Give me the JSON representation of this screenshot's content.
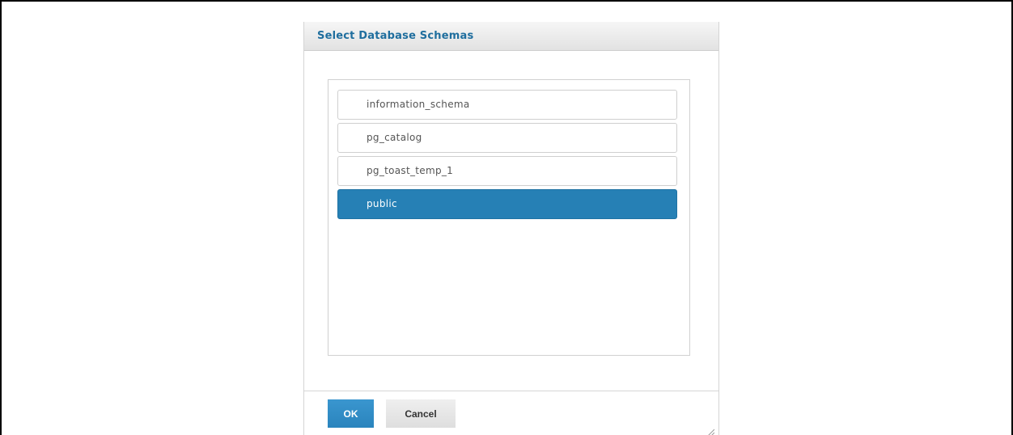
{
  "dialog": {
    "title": "Select Database Schemas"
  },
  "schemas": {
    "items": [
      {
        "label": "information_schema",
        "selected": false
      },
      {
        "label": "pg_catalog",
        "selected": false
      },
      {
        "label": "pg_toast_temp_1",
        "selected": false
      },
      {
        "label": "public",
        "selected": true
      }
    ]
  },
  "buttons": {
    "ok_label": "OK",
    "cancel_label": "Cancel"
  },
  "colors": {
    "title": "#1f6e9e",
    "selected_bg": "#2680b5",
    "ok_bg": "#2a84bd",
    "cancel_bg": "#dedede"
  },
  "icons": {
    "resize": "resize-grip-icon"
  }
}
